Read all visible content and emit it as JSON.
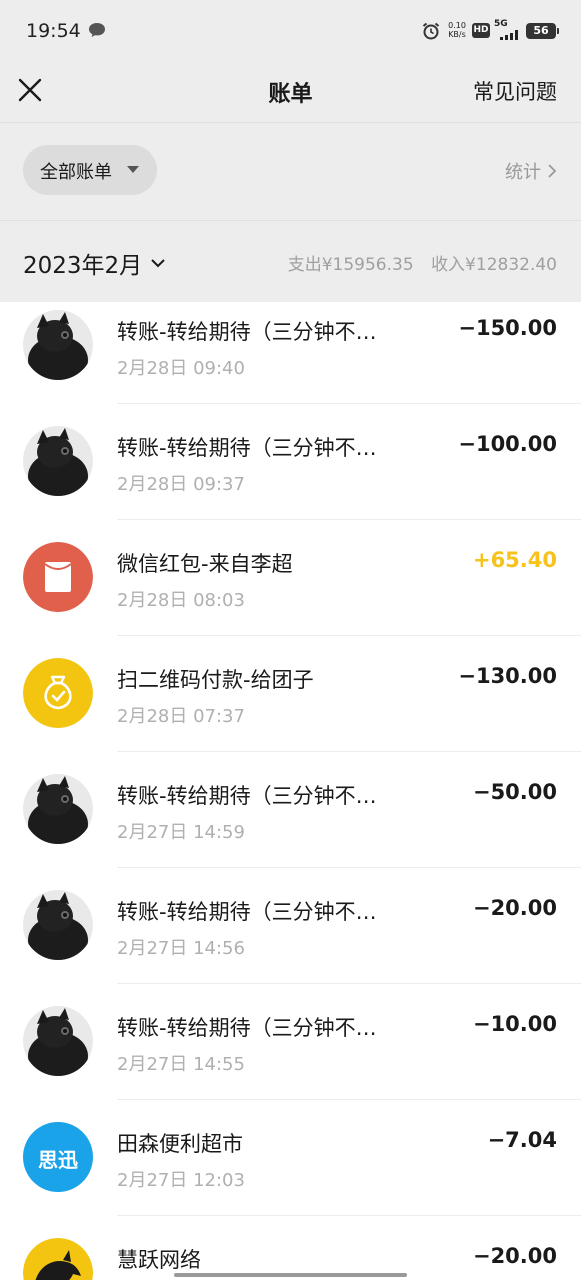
{
  "status_bar": {
    "time": "19:54",
    "net_speed_value": "0.10",
    "net_speed_unit": "KB/s",
    "hd": "HD",
    "network": "5G",
    "battery": "56"
  },
  "header": {
    "title": "账单",
    "faq": "常见问题"
  },
  "filter": {
    "all_bills": "全部账单",
    "stats": "统计"
  },
  "summary": {
    "month": "2023年2月",
    "expense": "支出¥15956.35",
    "income": "收入¥12832.40"
  },
  "transactions": [
    {
      "title": "转账-转给期待（三分钟不…",
      "time": "2月28日 09:40",
      "amount": "−150.00",
      "avatar": "dog-avatar"
    },
    {
      "title": "转账-转给期待（三分钟不…",
      "time": "2月28日 09:37",
      "amount": "−100.00",
      "avatar": "dog-avatar"
    },
    {
      "title": "微信红包-来自李超",
      "time": "2月28日 08:03",
      "amount": "+65.40",
      "avatar": "red-packet-icon"
    },
    {
      "title": "扫二维码付款-给团子",
      "time": "2月28日 07:37",
      "amount": "−130.00",
      "avatar": "money-bag-icon"
    },
    {
      "title": "转账-转给期待（三分钟不…",
      "time": "2月27日 14:59",
      "amount": "−50.00",
      "avatar": "dog-avatar"
    },
    {
      "title": "转账-转给期待（三分钟不…",
      "time": "2月27日 14:56",
      "amount": "−20.00",
      "avatar": "dog-avatar"
    },
    {
      "title": "转账-转给期待（三分钟不…",
      "time": "2月27日 14:55",
      "amount": "−10.00",
      "avatar": "dog-avatar"
    },
    {
      "title": "田森便利超市",
      "time": "2月27日 12:03",
      "amount": "−7.04",
      "avatar": "sixun-logo",
      "logo_text": "思迅"
    },
    {
      "title": "慧跃网络",
      "time": "",
      "amount": "−20.00",
      "avatar": "dragon-logo"
    }
  ],
  "colors": {
    "income": "#f7c21b",
    "red_packet": "#e0604c",
    "money_bag": "#f3c510",
    "sixun": "#1aa3e8"
  }
}
